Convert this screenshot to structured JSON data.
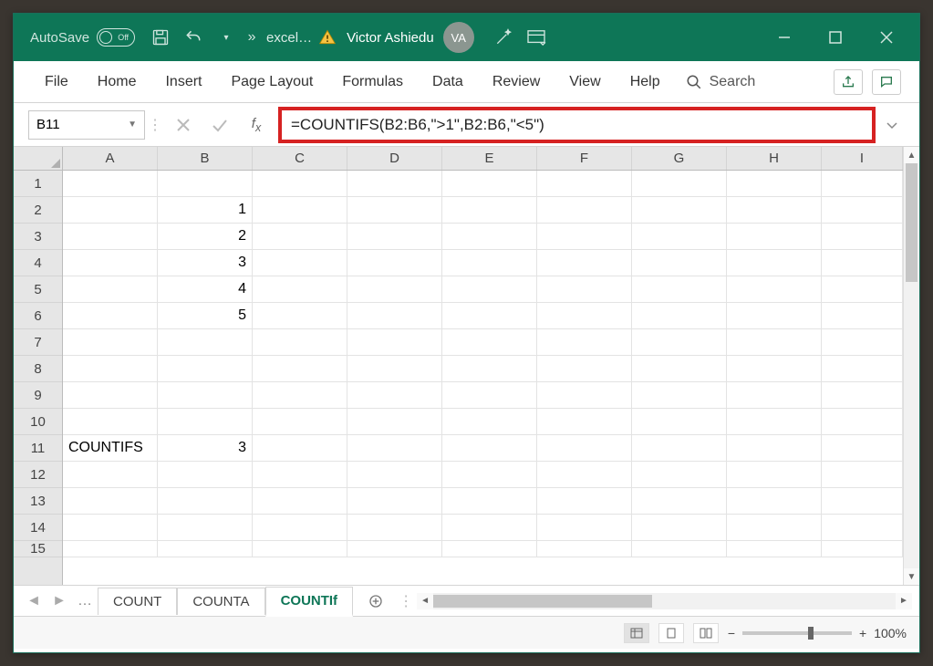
{
  "titlebar": {
    "autosave_label": "AutoSave",
    "autosave_state": "Off",
    "overflow": "»",
    "filename": "excel…",
    "username": "Victor Ashiedu",
    "avatar_initials": "VA"
  },
  "tabs": {
    "file": "File",
    "home": "Home",
    "insert": "Insert",
    "page_layout": "Page Layout",
    "formulas": "Formulas",
    "data": "Data",
    "review": "Review",
    "view": "View",
    "help": "Help",
    "search": "Search"
  },
  "formula_bar": {
    "name_box": "B11",
    "formula": "=COUNTIFS(B2:B6,\">1\",B2:B6,\"<5\")"
  },
  "columns": [
    "A",
    "B",
    "C",
    "D",
    "E",
    "F",
    "G",
    "H",
    "I"
  ],
  "rows": [
    "1",
    "2",
    "3",
    "4",
    "5",
    "6",
    "7",
    "8",
    "9",
    "10",
    "11",
    "12",
    "13",
    "14",
    "15"
  ],
  "cells": {
    "B2": "1",
    "B3": "2",
    "B4": "3",
    "B5": "4",
    "B6": "5",
    "A11": "COUNTIFS",
    "B11": "3"
  },
  "sheet_tabs": {
    "ellipsis": "…",
    "t1": "COUNT",
    "t2": "COUNTA",
    "t3": "COUNTIf"
  },
  "status": {
    "zoom": "100%"
  }
}
